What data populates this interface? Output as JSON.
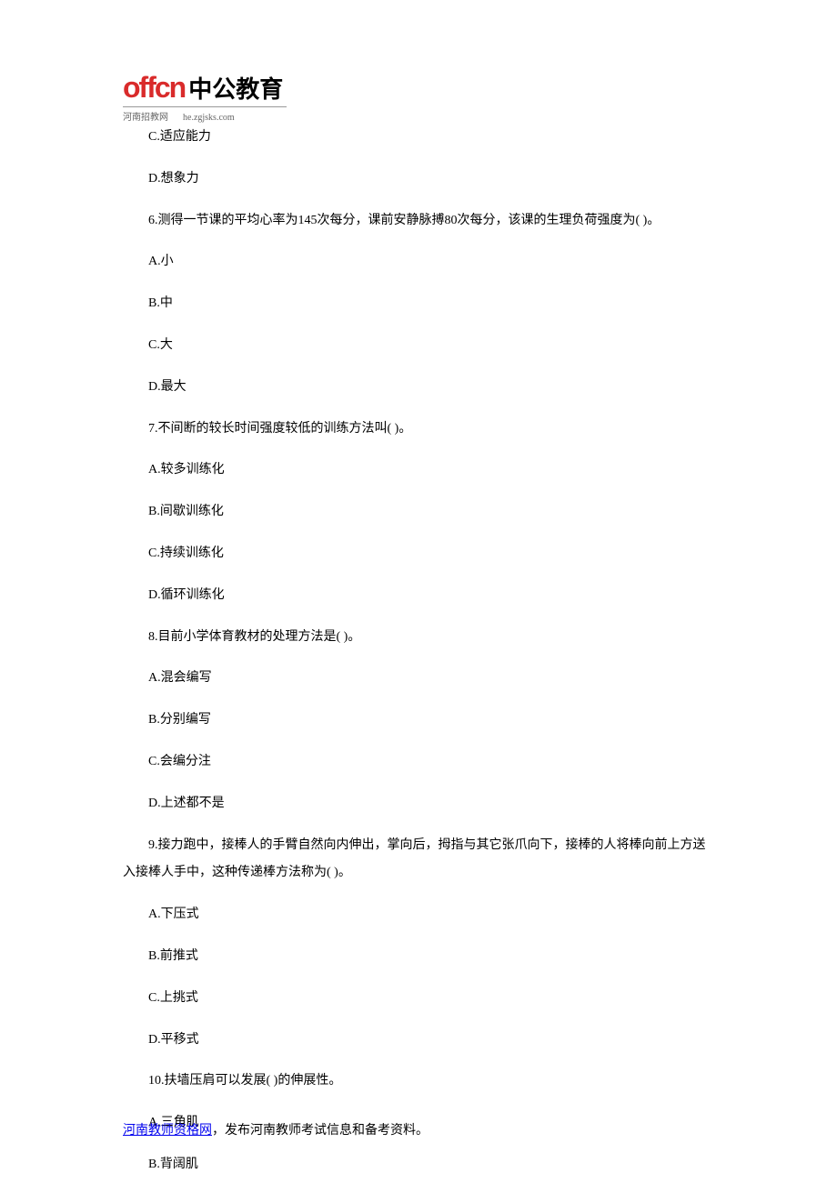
{
  "logo": {
    "offcn": "offcn",
    "chinese": "中公教育",
    "subtext_left": "河南招教网",
    "subtext_right": "he.zgjsks.com"
  },
  "options_top": [
    "C.适应能力",
    "D.想象力"
  ],
  "q6": {
    "text": "6.测得一节课的平均心率为145次每分，课前安静脉搏80次每分，该课的生理负荷强度为( )。",
    "options": [
      "A.小",
      "B.中",
      "C.大",
      "D.最大"
    ]
  },
  "q7": {
    "text": "7.不间断的较长时间强度较低的训练方法叫( )。",
    "options": [
      "A.较多训练化",
      "B.间歇训练化",
      "C.持续训练化",
      "D.循环训练化"
    ]
  },
  "q8": {
    "text": "8.目前小学体育教材的处理方法是( )。",
    "options": [
      "A.混会编写",
      "B.分别编写",
      "C.会编分注",
      "D.上述都不是"
    ]
  },
  "q9": {
    "text": "9.接力跑中，接棒人的手臂自然向内伸出，掌向后，拇指与其它张爪向下，接棒的人将棒向前上方送入接棒人手中，这种传递棒方法称为( )。",
    "options": [
      "A.下压式",
      "B.前推式",
      "C.上挑式",
      "D.平移式"
    ]
  },
  "q10": {
    "text": "10.扶墙压肩可以发展( )的伸展性。",
    "options": [
      "A.三角肌",
      "B.背阔肌"
    ]
  },
  "footer": {
    "link_text": "河南教师资格网",
    "suffix": "，发布河南教师考试信息和备考资料。"
  }
}
